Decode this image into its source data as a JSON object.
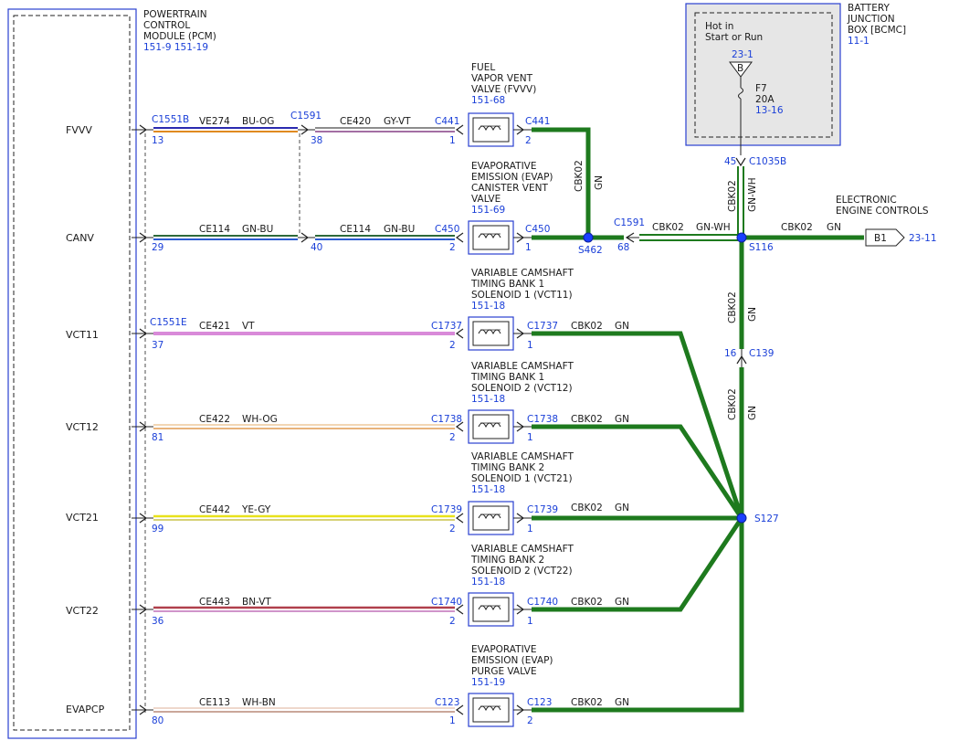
{
  "pcm": {
    "title": [
      "POWERTRAIN",
      "CONTROL",
      "MODULE (PCM)"
    ],
    "ref": "151-9  151-19",
    "pins": [
      "FVVV",
      "CANV",
      "VCT11",
      "VCT12",
      "VCT21",
      "VCT22",
      "EVAPCP"
    ]
  },
  "bjb": {
    "title": [
      "BATTERY",
      "JUNCTION",
      "BOX [BCMC]"
    ],
    "ref": "11-1",
    "hot_label": [
      "Hot in",
      "Start or Run"
    ],
    "bus_ref": "23-1",
    "bus_letter": "B",
    "fuse": [
      "F7",
      "20A"
    ],
    "fuse_ref": "13-16",
    "out_pin": "45",
    "out_conn": "C1035B"
  },
  "ecu": {
    "title": [
      "ELECTRONIC",
      "ENGINE CONTROLS"
    ],
    "tag": "B1",
    "ref": "23-11"
  },
  "fvvv_row": {
    "pcm_conn": "C1551B",
    "pcm_pin": "13",
    "w1_circ": "VE274",
    "w1_color": "BU-OG",
    "mid_conn": "C1591",
    "mid_pin": "38",
    "w2_circ": "CE420",
    "w2_color": "GY-VT",
    "dev_conn_in": "C441",
    "dev_pin_in": "1",
    "dev_conn_out": "C441",
    "dev_pin_out": "2",
    "dev_title": [
      "FUEL",
      "VAPOR VENT",
      "VALVE (FVVV)"
    ],
    "dev_ref": "151-68"
  },
  "canv_row": {
    "pcm_pin": "29",
    "w1_circ": "CE114",
    "w1_color": "GN-BU",
    "mid_pin": "40",
    "w2_circ": "CE114",
    "w2_color": "GN-BU",
    "dev_conn_in": "C450",
    "dev_pin_in": "2",
    "dev_conn_out": "C450",
    "dev_pin_out": "1",
    "dev_title": [
      "EVAPORATIVE",
      "EMISSION (EVAP)",
      "CANISTER VENT",
      "VALVE"
    ],
    "dev_ref": "151-69",
    "splice_1": "S462",
    "conn_1591": "C1591",
    "pin_68": "68",
    "wire_wh_circ": "CBK02",
    "wire_wh_color": "GN-WH",
    "splice_2": "S116",
    "wire_ecu_circ": "CBK02",
    "wire_ecu_color": "GN"
  },
  "vertical": {
    "fvvv_drop_circ": "CBK02",
    "fvvv_drop_color": "GN",
    "bjb_drop_circ": "CBK02",
    "bjb_drop_color": "GN-WH",
    "upper_circ": "CBK02",
    "upper_color": "GN",
    "c139_pin": "16",
    "c139_conn": "C139",
    "lower_circ": "CBK02",
    "lower_color": "GN",
    "splice_main": "S127"
  },
  "vct11_row": {
    "pcm_conn": "C1551E",
    "pcm_pin": "37",
    "circ": "CE421",
    "color": "VT",
    "dev_conn_in": "C1737",
    "dev_pin_in": "2",
    "dev_conn_out": "C1737",
    "dev_pin_out": "1",
    "gnd_circ": "CBK02",
    "gnd_color": "GN",
    "dev_title": [
      "VARIABLE CAMSHAFT",
      "TIMING BANK 1",
      "SOLENOID 1 (VCT11)"
    ],
    "dev_ref": "151-18"
  },
  "vct12_row": {
    "pcm_pin": "81",
    "circ": "CE422",
    "color": "WH-OG",
    "dev_conn_in": "C1738",
    "dev_pin_in": "2",
    "dev_conn_out": "C1738",
    "dev_pin_out": "1",
    "gnd_circ": "CBK02",
    "gnd_color": "GN",
    "dev_title": [
      "VARIABLE CAMSHAFT",
      "TIMING BANK 1",
      "SOLENOID 2 (VCT12)"
    ],
    "dev_ref": "151-18"
  },
  "vct21_row": {
    "pcm_pin": "99",
    "circ": "CE442",
    "color": "YE-GY",
    "dev_conn_in": "C1739",
    "dev_pin_in": "2",
    "dev_conn_out": "C1739",
    "dev_pin_out": "1",
    "gnd_circ": "CBK02",
    "gnd_color": "GN",
    "dev_title": [
      "VARIABLE CAMSHAFT",
      "TIMING BANK 2",
      "SOLENOID 1 (VCT21)"
    ],
    "dev_ref": "151-18"
  },
  "vct22_row": {
    "pcm_pin": "36",
    "circ": "CE443",
    "color": "BN-VT",
    "dev_conn_in": "C1740",
    "dev_pin_in": "2",
    "dev_conn_out": "C1740",
    "dev_pin_out": "1",
    "gnd_circ": "CBK02",
    "gnd_color": "GN",
    "dev_title": [
      "VARIABLE CAMSHAFT",
      "TIMING BANK 2",
      "SOLENOID 2 (VCT22)"
    ],
    "dev_ref": "151-18"
  },
  "evapcp_row": {
    "pcm_pin": "80",
    "circ": "CE113",
    "color": "WH-BN",
    "dev_conn_in": "C123",
    "dev_pin_in": "1",
    "dev_conn_out": "C123",
    "dev_pin_out": "2",
    "gnd_circ": "CBK02",
    "gnd_color": "GN",
    "dev_title": [
      "EVAPORATIVE",
      "EMISSION (EVAP)",
      "PURGE VALVE"
    ],
    "dev_ref": "151-19"
  },
  "colors": {
    "ground_green": "#1e7a1e",
    "frame_blue": "#2a3fd0",
    "BU-OG": "#2b2bb0",
    "GY-VT": "#a89096",
    "GN-BU": "#2e6a3a",
    "VT": "#d98ad9",
    "WH-OG": "#f2d6b4",
    "YE-GY": "#e8e21a",
    "BN-VT": "#b0404c",
    "WH-BN": "#eed8cc"
  }
}
